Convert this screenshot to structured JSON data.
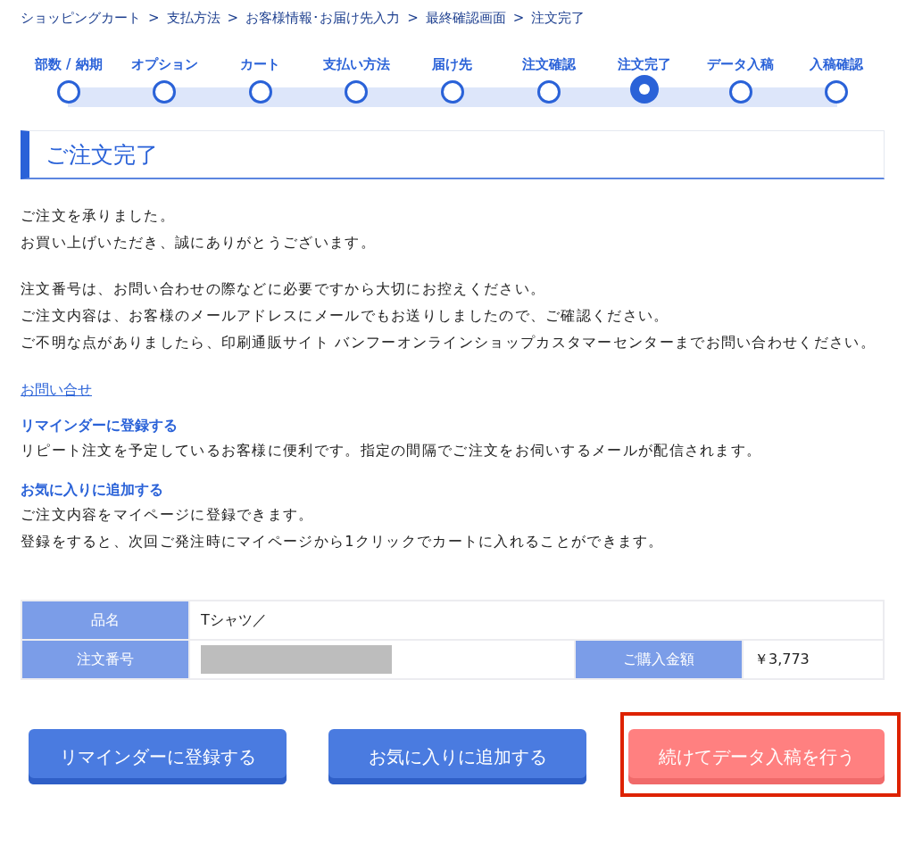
{
  "breadcrumb": [
    {
      "label": "ショッピングカート",
      "separator": ">"
    },
    {
      "label": "支払方法",
      "separator": ">"
    },
    {
      "label": "お客様情報･お届け先入力",
      "separator": ">"
    },
    {
      "label": "最終確認画面",
      "separator": ">"
    },
    {
      "label": "注文完了"
    }
  ],
  "steps": [
    {
      "label": "部数 / 納期",
      "selected": false
    },
    {
      "label": "オプション",
      "selected": false
    },
    {
      "label": "カート",
      "selected": false
    },
    {
      "label": "支払い方法",
      "selected": false
    },
    {
      "label": "届け先",
      "selected": false
    },
    {
      "label": "注文確認",
      "selected": false
    },
    {
      "label": "注文完了",
      "selected": true
    },
    {
      "label": "データ入稿",
      "selected": false
    },
    {
      "label": "入稿確認",
      "selected": false
    }
  ],
  "heading": "ご注文完了",
  "messages": [
    "ご注文を承りました。",
    "お買い上げいただき、誠にありがとうございます。"
  ],
  "notes": [
    "注文番号は、お問い合わせの際などに必要ですから大切にお控えください。",
    "ご注文内容は、お客様のメールアドレスにメールでもお送りしましたので、ご確認ください。",
    "ご不明な点がありましたら、印刷通販サイト バンフーオンラインショップカスタマーセンターまでお問い合わせください。"
  ],
  "contact_link": "お問い合せ",
  "sections": [
    {
      "title": "リマインダーに登録する",
      "lines": [
        "リピート注文を予定しているお客様に便利です。指定の間隔でご注文をお伺いするメールが配信されます。"
      ]
    },
    {
      "title": "お気に入りに追加する",
      "lines": [
        "ご注文内容をマイページに登録できます。",
        "登録をすると、次回ご発注時にマイページから1クリックでカートに入れることができます。"
      ]
    }
  ],
  "order_table": {
    "product_label": "品名",
    "product_value": "Tシャツ／",
    "number_label": "注文番号",
    "number_redacted": true,
    "amount_label": "ご購入金額",
    "amount_value": "￥3,773"
  },
  "buttons": [
    {
      "label": "リマインダーに登録する",
      "kind": "primary",
      "highlighted": false
    },
    {
      "label": "お気に入りに追加する",
      "kind": "primary",
      "highlighted": false
    },
    {
      "label": "続けてデータ入稿を行う",
      "kind": "accent",
      "highlighted": true
    }
  ]
}
